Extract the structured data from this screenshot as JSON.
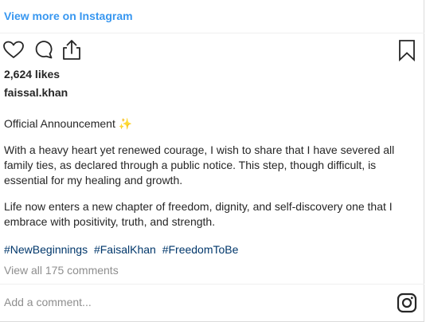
{
  "embed": {
    "view_more_label": "View more on Instagram"
  },
  "actions": {
    "icons": [
      "heart-icon",
      "comment-icon",
      "share-icon",
      "bookmark-icon"
    ]
  },
  "post": {
    "likes": "2,624 likes",
    "username": "faissal.khan",
    "caption": {
      "announcement": "Official Announcement",
      "announcement_emoji": "✨",
      "paragraph_1": "With a heavy heart yet renewed courage, I wish to share that I have severed all family ties, as declared through a public notice. This step, though difficult, is essential for my healing and growth.",
      "paragraph_2": "Life now enters a new chapter of freedom, dignity, and self-discovery one that I embrace with positivity, truth, and strength."
    },
    "hashtags": [
      "#NewBeginnings",
      "#FaisalKhan",
      "#FreedomToBe"
    ],
    "view_comments": "View all 175 comments"
  },
  "comment_box": {
    "placeholder": "Add a comment..."
  },
  "colors": {
    "link_blue": "#3897f0",
    "hashtag": "#00376b",
    "muted": "#8e8e8e",
    "text": "#262626"
  }
}
